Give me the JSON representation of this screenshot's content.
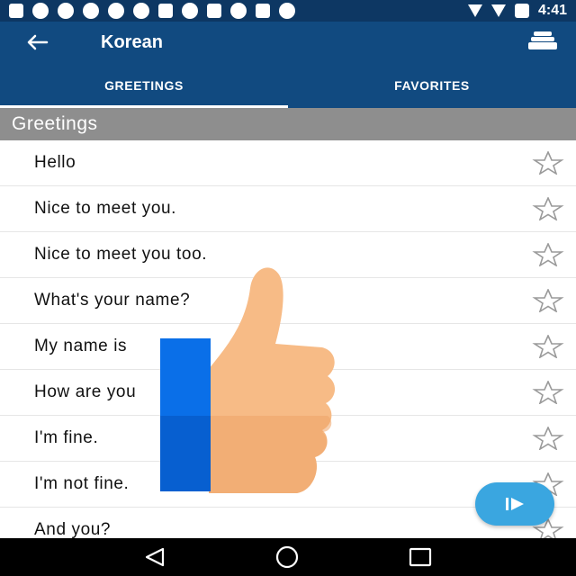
{
  "status_bar": {
    "time": "4:41"
  },
  "app_bar": {
    "title": "Korean"
  },
  "tabs": [
    {
      "label": "GREETINGS",
      "active": true
    },
    {
      "label": "FAVORITES",
      "active": false
    }
  ],
  "section": {
    "title": "Greetings"
  },
  "phrases": [
    "Hello",
    "Nice to meet you.",
    "Nice to meet you too.",
    "What's your name?",
    "My name is",
    "How are you",
    "I'm fine.",
    "I'm not fine.",
    "And you?"
  ],
  "colors": {
    "status_bar": "#0d3763",
    "primary": "#114a80",
    "section_header": "#8e8e8e",
    "fab": "#3aa6e0",
    "thumb_skin": "#f7bb86",
    "thumb_blue": "#0a6fe8"
  },
  "icons": {
    "back": "arrow-left-icon",
    "menu": "stack-icon",
    "star": "star-outline-icon",
    "fab": "play-icon"
  }
}
